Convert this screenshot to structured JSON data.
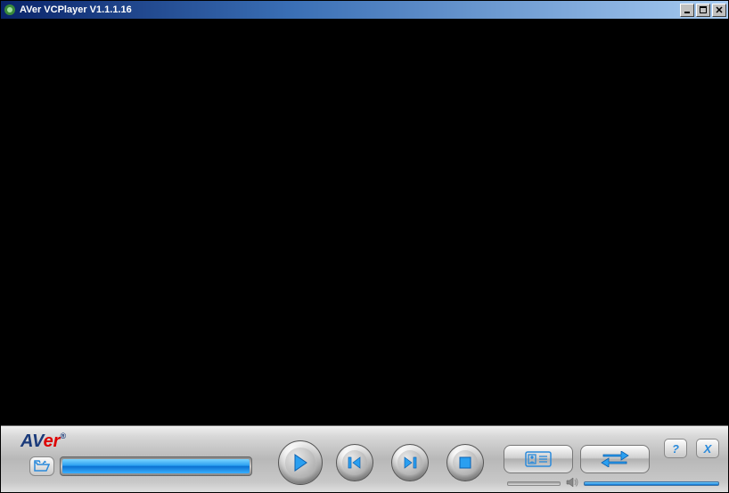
{
  "window": {
    "title": "AVer VCPlayer V1.1.1.16"
  },
  "logo": {
    "brand_prefix": "AV",
    "brand_accent": "er",
    "tm": "®"
  },
  "icons": {
    "open": "folder-open-icon",
    "play": "play-icon",
    "prev": "skip-previous-icon",
    "next": "skip-next-icon",
    "stop": "stop-icon",
    "contact": "contact-card-icon",
    "swap": "swap-arrows-icon",
    "help": "?",
    "close": "X",
    "speaker": "speaker-icon"
  },
  "progress": {
    "percent": 100
  },
  "volume": {
    "percent": 100
  }
}
